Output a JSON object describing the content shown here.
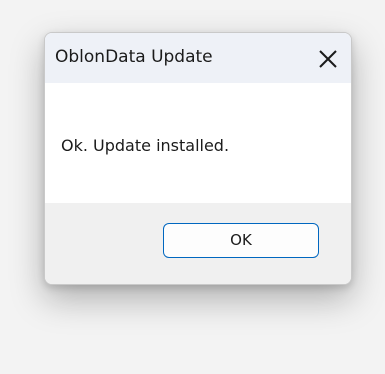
{
  "window": {
    "title": "OblonData Update",
    "close_icon": "close-icon"
  },
  "content": {
    "message": "Ok. Update installed."
  },
  "footer": {
    "ok_label": "OK"
  },
  "colors": {
    "accent": "#0067c0",
    "titlebar": "#eef1f7",
    "footer": "#f0f0f0"
  }
}
